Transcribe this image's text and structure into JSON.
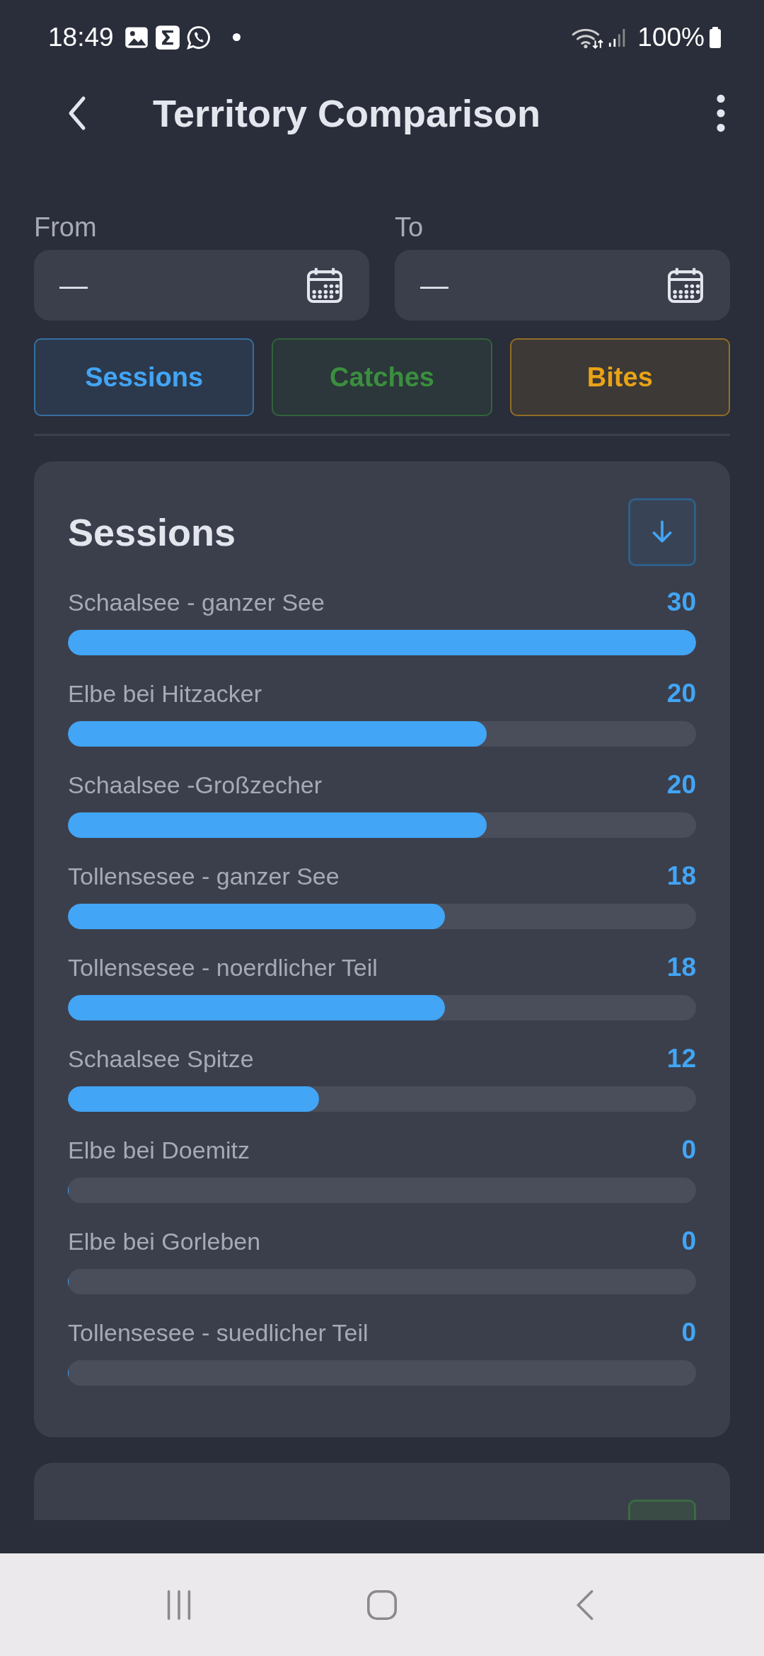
{
  "status_bar": {
    "time": "18:49",
    "battery": "100%"
  },
  "header": {
    "title": "Territory Comparison"
  },
  "date_range": {
    "from": {
      "label": "From",
      "value": "—"
    },
    "to": {
      "label": "To",
      "value": "—"
    }
  },
  "metric_tabs": [
    {
      "label": "Sessions",
      "color": "#42a5f5"
    },
    {
      "label": "Catches",
      "color": "#3a8f3e"
    },
    {
      "label": "Bites",
      "color": "#e8a317"
    }
  ],
  "sessions_card": {
    "title": "Sessions",
    "rows": [
      {
        "name": "Schaalsee - ganzer See",
        "value": "30",
        "level": 1.0
      },
      {
        "name": "Elbe bei Hitzacker",
        "value": "20",
        "level": 0.667
      },
      {
        "name": "Schaalsee -Großzecher",
        "value": "20",
        "level": 0.667
      },
      {
        "name": "Tollensesee - ganzer See",
        "value": "18",
        "level": 0.6
      },
      {
        "name": "Tollensesee - noerdlicher Teil",
        "value": "18",
        "level": 0.6
      },
      {
        "name": "Schaalsee Spitze",
        "value": "12",
        "level": 0.4
      },
      {
        "name": "Elbe bei Doemitz",
        "value": "0",
        "level": 0
      },
      {
        "name": "Elbe bei Gorleben",
        "value": "0",
        "level": 0
      },
      {
        "name": "Tollensesee - suedlicher Teil",
        "value": "0",
        "level": 0
      }
    ]
  }
}
